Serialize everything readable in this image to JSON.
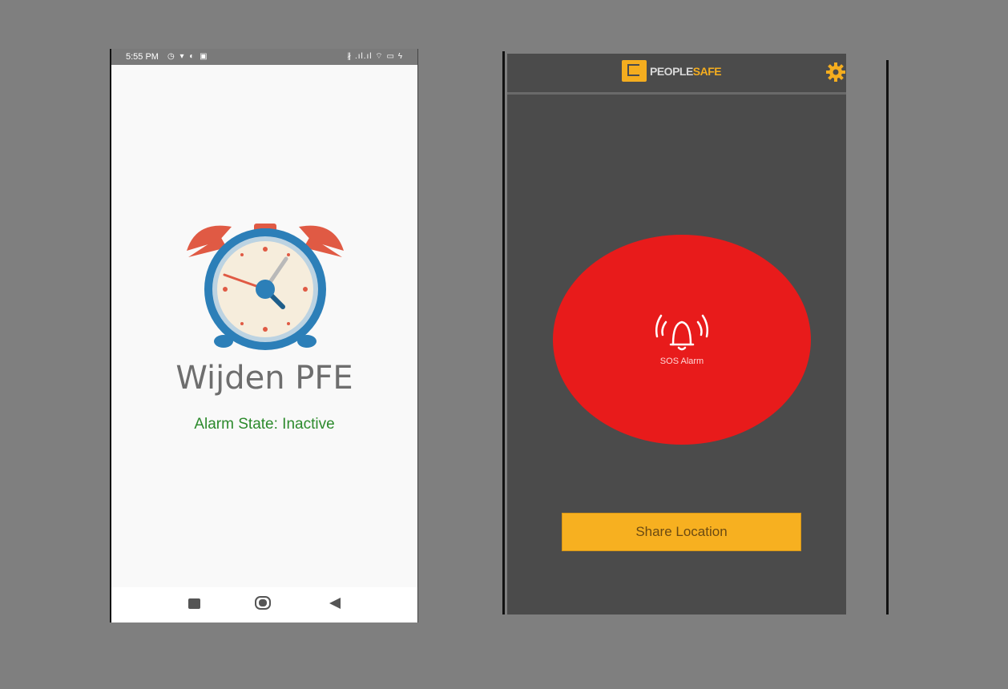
{
  "left_screen": {
    "status_bar": {
      "time": "5:55 PM",
      "left_icons": "◷ ▾ ◐ ▣",
      "right_icons": "∦ .ıl.ıl ⌔ ▭ ϟ"
    },
    "app_title": "Wijden PFE",
    "alarm_state": "Alarm State: Inactive",
    "icons": [
      "alarm-clock-icon",
      "recent-apps-icon",
      "home-icon",
      "back-icon"
    ]
  },
  "right_screen": {
    "brand": {
      "part1": "PEOPLE",
      "part2": "SAFE"
    },
    "sos_label": "SOS Alarm",
    "share_button_label": "Share Location",
    "icons": [
      "logo-icon",
      "gear-icon",
      "alarm-bell-icon"
    ]
  },
  "colors": {
    "background": "#7f7f7f",
    "accent": "#f4ad1f",
    "sos_red": "#e81b1b",
    "status_green": "#2c8a2c",
    "dark_panel": "#4b4b4b"
  }
}
